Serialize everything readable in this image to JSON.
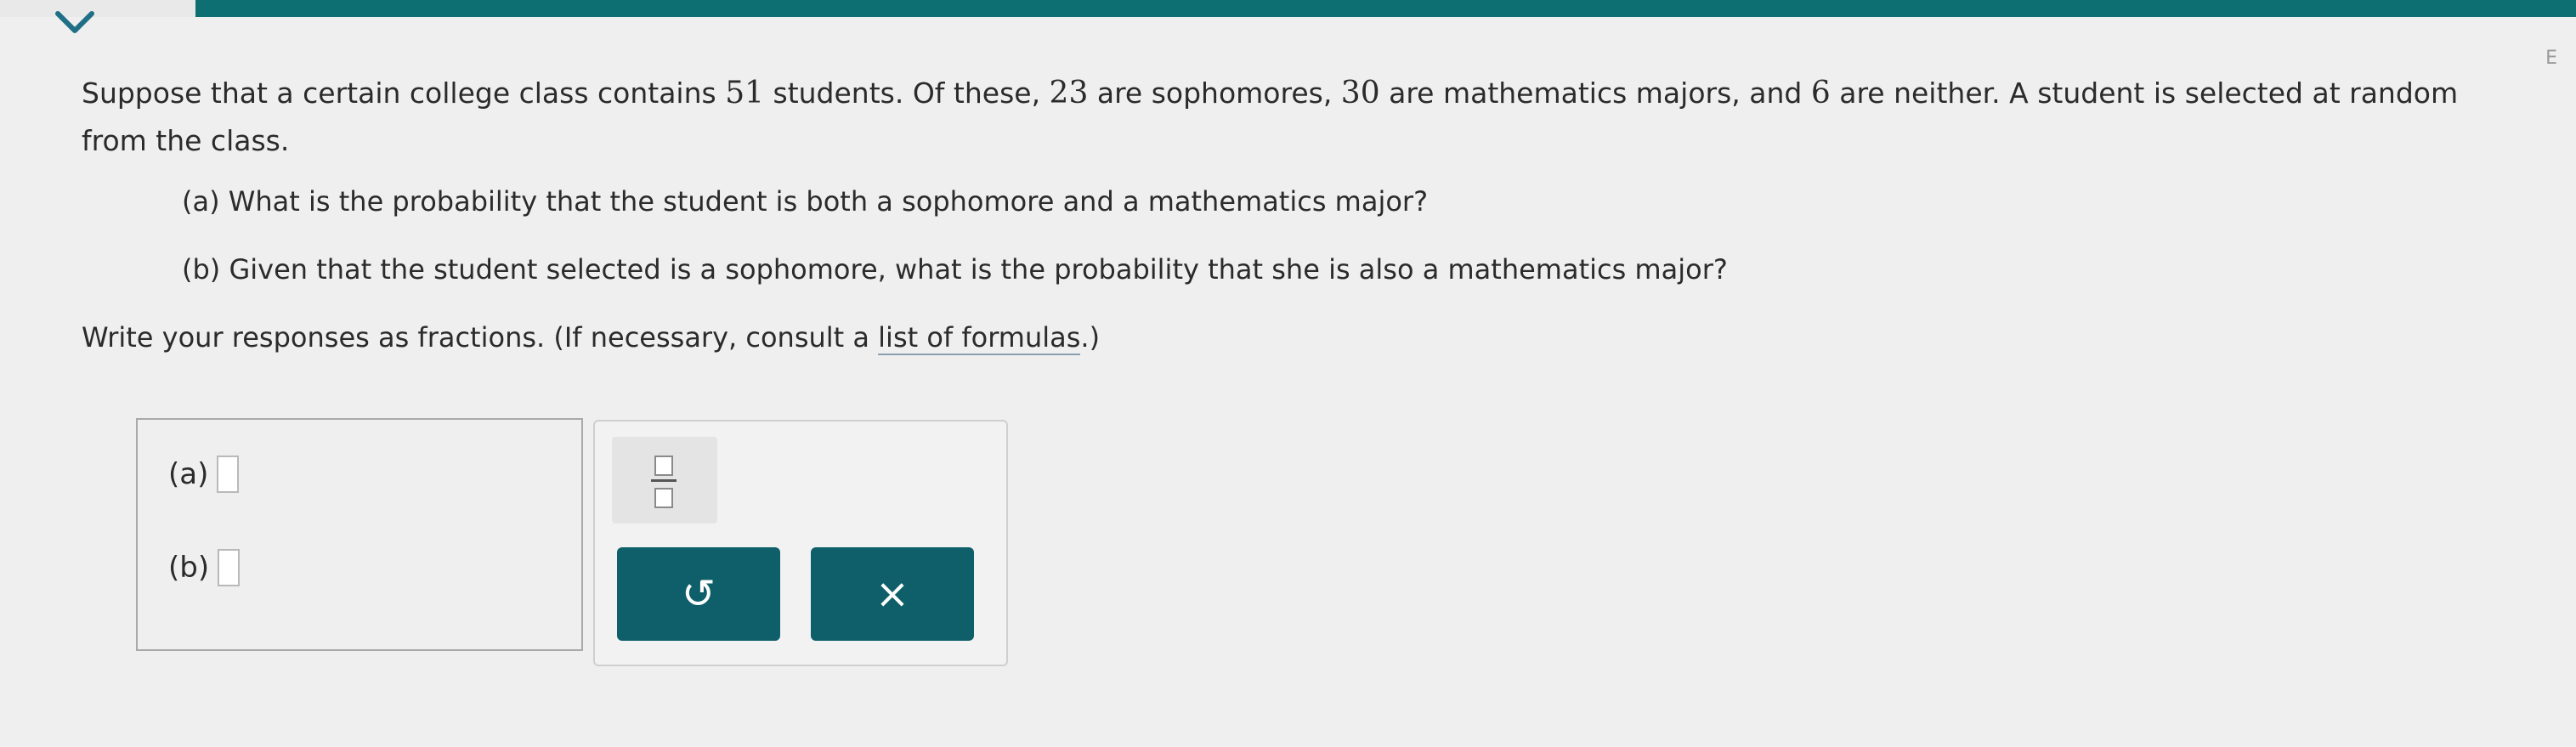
{
  "header": {
    "collapse_icon": "chevron-down-icon",
    "edge_letter": "E"
  },
  "problem": {
    "text_1": "Suppose that a certain college class contains ",
    "n_students": "51",
    "text_2": " students. Of these, ",
    "n_sophomores": "23",
    "text_3": " are sophomores, ",
    "n_math": "30",
    "text_4": " are mathematics majors, and ",
    "n_neither": "6",
    "text_5": " are neither. A student is selected at random from the class."
  },
  "questions": {
    "a": "(a) What is the probability that the student is both a sophomore and a mathematics major?",
    "b": "(b) Given that the student selected is a sophomore, what is the probability that she is also a mathematics major?"
  },
  "instructions": {
    "text_before": "Write your responses as fractions. (If necessary, consult a ",
    "link_label": "list of formulas",
    "text_after": ".)"
  },
  "answers": {
    "a_label": "(a)",
    "a_value": "",
    "b_label": "(b)",
    "b_value": ""
  },
  "toolbar": {
    "fraction_icon": "fraction-icon",
    "undo_icon": "undo-icon",
    "undo_glyph": "↺",
    "clear_icon": "close-icon",
    "clear_glyph": "×"
  }
}
